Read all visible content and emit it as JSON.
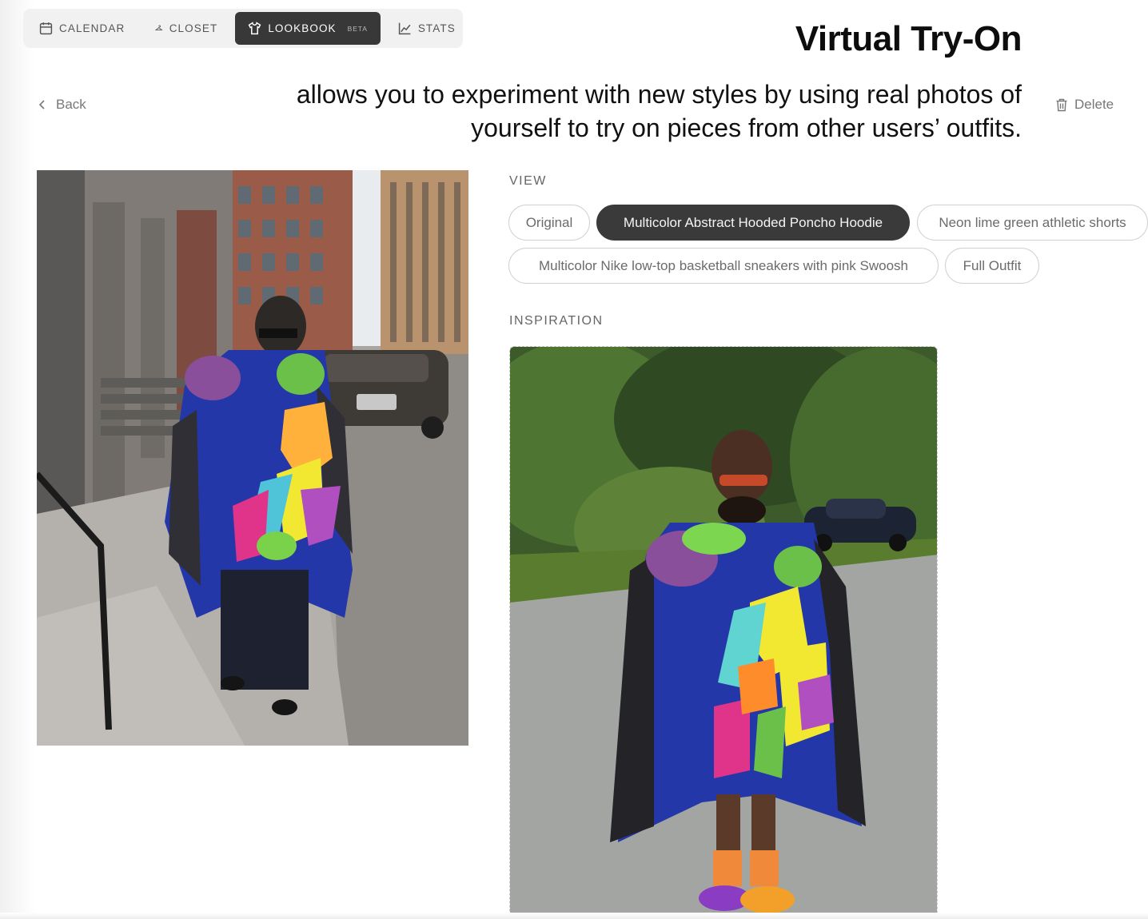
{
  "tabs": [
    {
      "label": "CALENDAR",
      "icon": "calendar-icon"
    },
    {
      "label": "CLOSET",
      "icon": "hanger-icon"
    },
    {
      "label": "LOOKBOOK",
      "icon": "shirt-icon",
      "badge": "BETA",
      "active": true
    },
    {
      "label": "STATS",
      "icon": "line-chart-icon"
    }
  ],
  "overlay": {
    "title": "Virtual Try-On",
    "description": "allows you to experiment with new styles by using real photos of yourself to try on pieces from other users’ outfits."
  },
  "back_label": "Back",
  "delete_label": "Delete",
  "view": {
    "label": "VIEW",
    "options": [
      "Original",
      "Multicolor Abstract Hooded Poncho Hoodie",
      "Neon lime green athletic shorts",
      "Multicolor Nike low-top basketball sneakers with pink Swoosh",
      "Full Outfit"
    ],
    "selected": "Multicolor Abstract Hooded Poncho Hoodie"
  },
  "inspiration": {
    "label": "INSPIRATION"
  },
  "colors": {
    "active_tab": "#383838",
    "tab_bar": "#f1f1f1",
    "chip_selected": "#3a3a3a",
    "muted_text": "#777777"
  }
}
